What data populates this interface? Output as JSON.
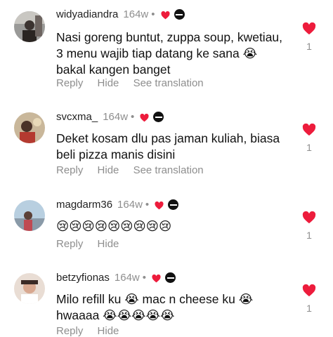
{
  "colors": {
    "heart": "#ed1c3c",
    "muted": "#8e8e8e",
    "text": "#111111"
  },
  "comments": [
    {
      "username": "widyadiandra",
      "time": "164w",
      "dot": "•",
      "text": "Nasi goreng buntut, zuppa soup, kwetiau, 3 menu wajib tiap datang ke sana 😭 bakal kangen banget",
      "actions": {
        "reply": "Reply",
        "hide": "Hide",
        "translate": "See translation"
      },
      "likes": "1"
    },
    {
      "username": "svcxma_",
      "time": "164w",
      "dot": "•",
      "text": "Deket kosam dlu pas jaman kuliah, biasa beli pizza manis disini",
      "actions": {
        "reply": "Reply",
        "hide": "Hide",
        "translate": "See translation"
      },
      "likes": "1"
    },
    {
      "username": "magdarm36",
      "time": "164w",
      "dot": "•",
      "text": "😢😢😢😢😢😢😢😢😢",
      "actions": {
        "reply": "Reply",
        "hide": "Hide"
      },
      "likes": "1"
    },
    {
      "username": "betzyfionas",
      "time": "164w",
      "dot": "•",
      "text": "Milo refill ku 😭 mac n cheese ku 😭 hwaaaa 😭😭😭😭😭",
      "actions": {
        "reply": "Reply",
        "hide": "Hide"
      },
      "likes": "1"
    }
  ]
}
